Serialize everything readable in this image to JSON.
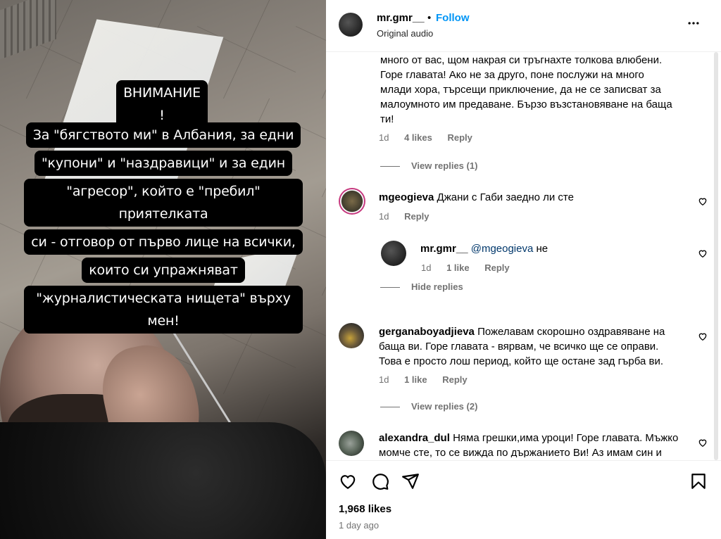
{
  "story": {
    "title": "ВНИМАНИЕ !",
    "lines": [
      "За \"бягството ми\" в Албания, за едни",
      "\"купони\" и \"наздравици\" и за един",
      "\"агресор\", който е \"пребил\" приятелката",
      "си - отговор от първо лице на всички,",
      "които си упражняват",
      "\"журналистическата нищета\" върху мен!"
    ]
  },
  "header": {
    "username": "mr.gmr__",
    "dot": "•",
    "follow": "Follow",
    "subtitle": "Original audio",
    "more_icon": "more-horizontal-icon"
  },
  "comments": [
    {
      "text_lines": [
        "много от вас, щом накрая си тръгнахте толкова влюбени.",
        "Горе главата! Ако не за друго, поне послужи на много",
        "млади хора, търсещи приключение, да не се записват за",
        "малоумното им предаване. Бързо възстановяване на баща",
        "ти!"
      ],
      "time": "1d",
      "likes": "4 likes",
      "reply": "Reply",
      "view_replies": "View replies (1)"
    },
    {
      "username": "mgeogieva",
      "text": "Джани с Габи заедно ли сте",
      "time": "1d",
      "reply": "Reply",
      "reply_item": {
        "username": "mr.gmr__",
        "mention": "@mgeogieva",
        "text": "не",
        "time": "1d",
        "likes": "1 like",
        "reply": "Reply"
      },
      "hide_replies": "Hide replies"
    },
    {
      "username": "gerganaboyadjieva",
      "text_first": "Пожелавам скорошно оздравяване на",
      "text_lines": [
        "баща ви. Горе главата - вярвам, че всичко ще се оправи.",
        "Това е просто лош период, който ще остане зад гърба ви."
      ],
      "time": "1d",
      "likes": "1 like",
      "reply": "Reply",
      "view_replies": "View replies (2)"
    },
    {
      "username": "alexandra_dul",
      "text_first": "Няма грешки,има уроци! Горе главата. Мъжко",
      "text_lines": [
        "момче сте, то се вижда по държанието Ви! Аз имам син и"
      ]
    }
  ],
  "actions": {
    "like_icon": "heart-icon",
    "comment_icon": "comment-icon",
    "share_icon": "share-icon",
    "save_icon": "bookmark-icon",
    "likes": "1,968 likes",
    "ago": "1 day ago"
  }
}
